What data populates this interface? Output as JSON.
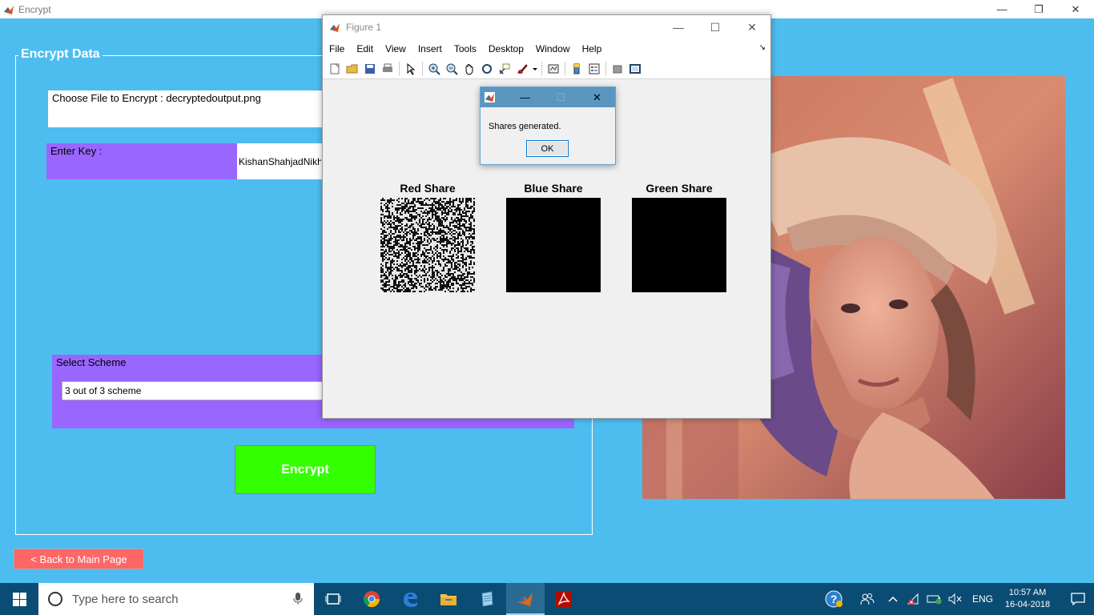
{
  "main_window": {
    "title": "Encrypt",
    "controls": {
      "minimize": "—",
      "restore": "❐",
      "close": "✕"
    }
  },
  "encrypt_form": {
    "legend": "Encrypt Data",
    "file_label": "Choose File to Encrypt : decryptedoutput.png",
    "key_label": "Enter Key :",
    "key_value": "KishanShahjadNikhil",
    "scheme_label": "Select Scheme",
    "scheme_selected": "3 out of 3 scheme",
    "encrypt_button": "Encrypt",
    "back_button": "< Back to Main Page"
  },
  "figure_window": {
    "title": "Figure 1",
    "menu": [
      "File",
      "Edit",
      "View",
      "Insert",
      "Tools",
      "Desktop",
      "Window",
      "Help"
    ],
    "controls": {
      "minimize": "—",
      "maximize": "☐",
      "close": "✕"
    },
    "toolbar_icons": [
      "new-figure-icon",
      "open-file-icon",
      "save-icon",
      "print-icon",
      "pointer-icon",
      "zoom-in-icon",
      "zoom-out-icon",
      "pan-icon",
      "rotate-3d-icon",
      "data-cursor-icon",
      "brush-icon",
      "link-plot-icon",
      "colorbar-icon",
      "legend-icon",
      "hide-plot-tools-icon",
      "show-plot-tools-icon"
    ],
    "shares": [
      {
        "title": "Red Share",
        "style": "noise"
      },
      {
        "title": "Blue Share",
        "style": "black"
      },
      {
        "title": "Green Share",
        "style": "black"
      }
    ]
  },
  "dialog": {
    "message": "Shares generated.",
    "ok_button": "OK",
    "controls": {
      "minimize": "—",
      "maximize": "☐",
      "close": "✕"
    }
  },
  "taskbar": {
    "search_placeholder": "Type here to search",
    "apps": [
      "task-view-icon",
      "chrome-icon",
      "edge-icon",
      "file-explorer-icon",
      "notepad-icon",
      "matlab-icon",
      "acrobat-icon"
    ],
    "language": "ENG",
    "time": "10:57 AM",
    "date": "16-04-2018"
  },
  "colors": {
    "background": "#4dbdf0",
    "purple_panel": "#9966ff",
    "encrypt_green": "#33ff00",
    "back_red": "#ff6666",
    "taskbar": "#0b4c74"
  }
}
